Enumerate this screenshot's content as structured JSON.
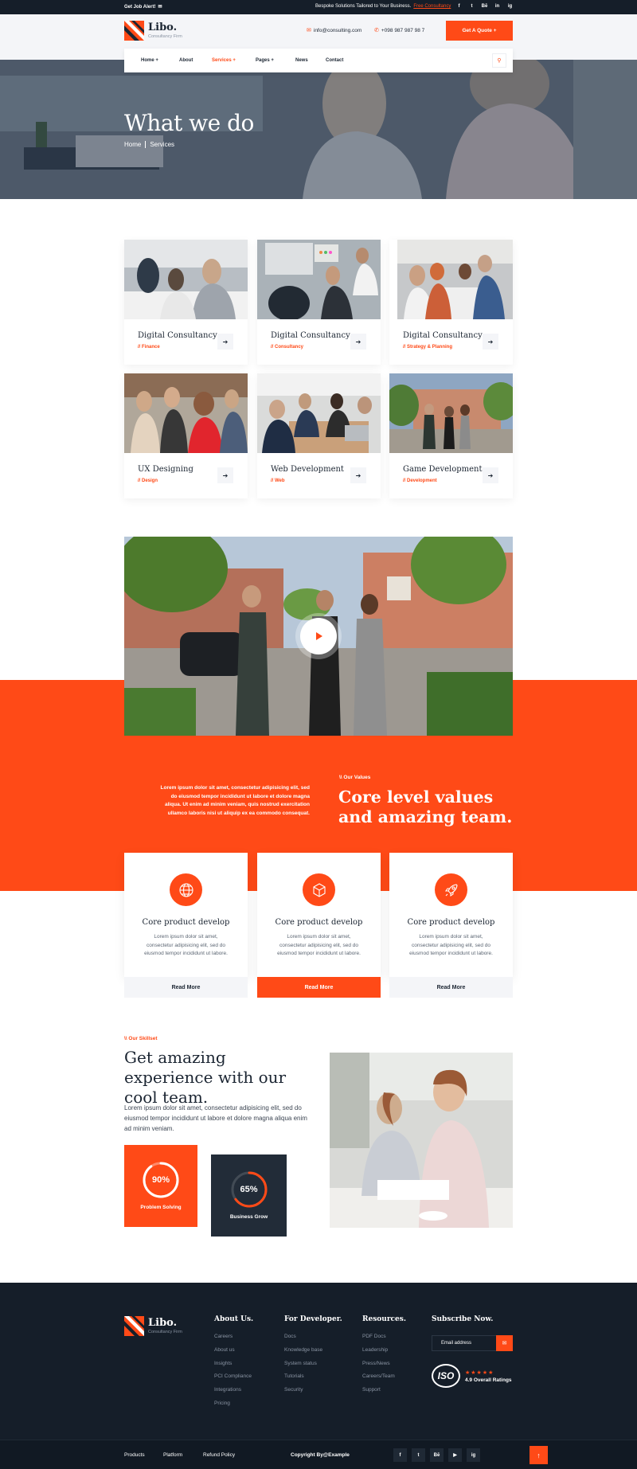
{
  "topbar": {
    "alert": "Get Job Alert!",
    "tagline": "Bespoke Solutions Tailored to Your Business.",
    "tagline_link": "Free Consultancy",
    "social": [
      "f",
      "t",
      "Bē",
      "in",
      "ig"
    ]
  },
  "header": {
    "logo_name": "Libo.",
    "logo_sub": "Consultancy Firm",
    "email": "info@consulting.com",
    "phone": "+098 987 987 98 7",
    "quote_button": "Get A Quote +"
  },
  "nav": {
    "items": [
      "Home +",
      "About",
      "Services +",
      "Pages +",
      "News",
      "Contact"
    ],
    "active": "Services +"
  },
  "hero": {
    "title": "What we do",
    "breadcrumb_home": "Home",
    "breadcrumb_current": "Services"
  },
  "services": [
    {
      "title": "Digital Consultancy",
      "category": "// Finance"
    },
    {
      "title": "Digital Consultancy",
      "category": "// Consultancy"
    },
    {
      "title": "Digital Consultancy",
      "category": "// Strategy & Planning"
    },
    {
      "title": "UX Designing",
      "category": "// Design"
    },
    {
      "title": "Web Development",
      "category": "// Web"
    },
    {
      "title": "Game Development",
      "category": "// Development"
    }
  ],
  "values": {
    "text": "Lorem ipsum dolor sit amet, consectetur adipisicing elit, sed do eiusmod tempor incididunt ut labore et dolore magna aliqua. Ut enim ad minim veniam, quis nostrud exercitation ullamco laboris nisi ut aliquip ex ea commodo consequat.",
    "label": "\\\\ Our Values",
    "heading": "Core level values and amazing team.",
    "cards": [
      {
        "title": "Core product develop",
        "desc": "Lorem ipsum dolor sit amet, consectetur adipisicing elit, sed do eiusmod tempor incididunt ut labore.",
        "button": "Read More",
        "icon": "globe-icon"
      },
      {
        "title": "Core product develop",
        "desc": "Lorem ipsum dolor sit amet, consectetur adipisicing elit, sed do eiusmod tempor incididunt ut labore.",
        "button": "Read More",
        "icon": "cube-icon"
      },
      {
        "title": "Core product develop",
        "desc": "Lorem ipsum dolor sit amet, consectetur adipisicing elit, sed do eiusmod tempor incididunt ut labore.",
        "button": "Read More",
        "icon": "rocket-icon"
      }
    ]
  },
  "skills": {
    "label": "\\\\ Our Skillset",
    "heading": "Get amazing experience with our cool team.",
    "text": "Lorem ipsum dolor sit amet, consectetur adipisicing elit, sed do eiusmod tempor incididunt ut labore et dolore magna aliqua enim ad minim veniam.",
    "stats": [
      {
        "value": "90%",
        "label": "Problem Solving",
        "percent": 90
      },
      {
        "value": "65%",
        "label": "Business Grow",
        "percent": 65
      }
    ]
  },
  "footer": {
    "logo_name": "Libo.",
    "logo_sub": "Consultancy Firm",
    "col1_title": "About Us.",
    "col1_links": [
      "Careers",
      "About us",
      "Insights",
      "PCI Compliance",
      "Integrations",
      "Pricing"
    ],
    "col2_title": "For Developer.",
    "col2_links": [
      "Docs",
      "Knowledge base",
      "System status",
      "Tutorials",
      "Security"
    ],
    "col3_title": "Resources.",
    "col3_links": [
      "PDF Docs",
      "Leadership",
      "Press/News",
      "Careers/Team",
      "Support"
    ],
    "col4_title": "Subscribe Now.",
    "email_placeholder": "Email address",
    "iso_badge": "ISO",
    "rating_text": "4.9 Overall Ratings",
    "stars": "★★★★★"
  },
  "bottom": {
    "links": [
      "Products",
      "Platform",
      "Refund Policy"
    ],
    "copyright": "Copyright By@Example",
    "social": [
      "f",
      "t",
      "Bē",
      "▶",
      "ig"
    ],
    "to_top": "↑"
  },
  "colors": {
    "accent": "#ff4a17",
    "dark": "#151e29"
  }
}
